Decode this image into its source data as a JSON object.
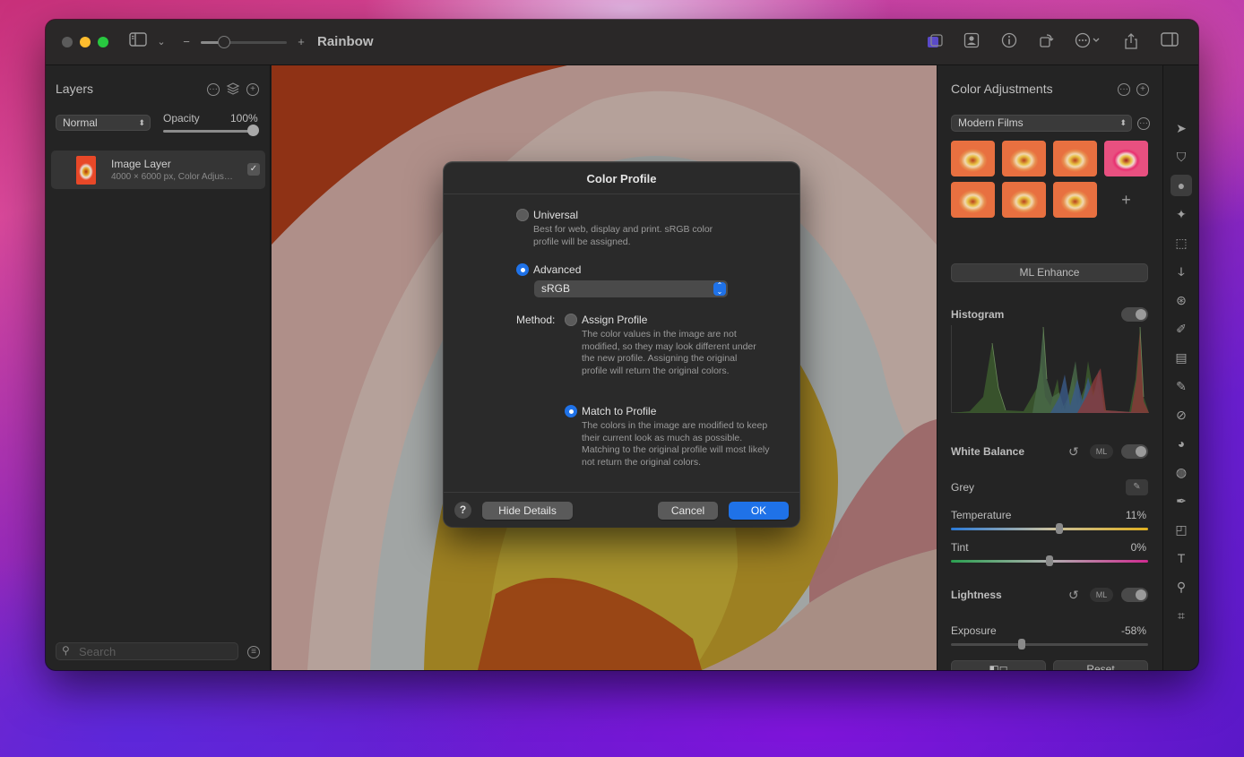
{
  "window": {
    "title": "Rainbow"
  },
  "layers_panel": {
    "title": "Layers",
    "blend_mode": "Normal",
    "opacity_label": "Opacity",
    "opacity_value": "100%",
    "opacity_fraction": 1.0,
    "layers": [
      {
        "name": "Image Layer",
        "meta": "4000 × 6000 px, Color Adjus…",
        "visible": true
      }
    ],
    "search_placeholder": "Search"
  },
  "adjustments_panel": {
    "title": "Color Adjustments",
    "preset_group": "Modern Films",
    "preset_add": "+",
    "ml_enhance": "ML Enhance",
    "histogram": {
      "title": "Histogram"
    },
    "white_balance": {
      "title": "White Balance",
      "ml": "ML",
      "grey_label": "Grey",
      "temperature_label": "Temperature",
      "temperature_value": "11%",
      "temperature_fraction": 0.55,
      "tint_label": "Tint",
      "tint_value": "0%",
      "tint_fraction": 0.5
    },
    "lightness": {
      "title": "Lightness",
      "ml": "ML",
      "exposure_label": "Exposure",
      "exposure_value": "-58%",
      "exposure_fraction": 0.36
    },
    "compare_button": "◧◻",
    "reset_button": "Reset"
  },
  "dialog": {
    "title": "Color Profile",
    "universal": {
      "label": "Universal",
      "description": "Best for web, display and print. sRGB color profile will be assigned.",
      "selected": false
    },
    "advanced": {
      "label": "Advanced",
      "selected": true,
      "profile": "sRGB"
    },
    "method_label": "Method:",
    "assign_profile": {
      "label": "Assign Profile",
      "description": "The color values in the image are not modified, so they may look different under the new profile. Assigning the original profile will return the original colors.",
      "selected": false
    },
    "match_profile": {
      "label": "Match to Profile",
      "description": "The colors in the image are modified to keep their current look as much as possible. Matching to the original profile will most likely not return the original colors.",
      "selected": true
    },
    "help": "?",
    "hide_details": "Hide Details",
    "cancel": "Cancel",
    "ok": "OK"
  },
  "colors": {
    "accent": "#1f72e8",
    "window_bg": "#1f1f1f",
    "panel_bg": "#242424"
  },
  "icons": {
    "toolbar_left": [
      "sidebar-icon",
      "chevron-down-icon",
      "zoom-out-icon",
      "zoom-in-icon"
    ],
    "toolbar_right": [
      "color-profile-icon",
      "person-icon",
      "info-icon",
      "rotate-icon",
      "more-icon",
      "share-icon",
      "sidebar-right-icon"
    ],
    "tools": [
      "arrow-icon",
      "paint-bucket-icon",
      "color-adjust-icon",
      "magic-icon",
      "marquee-icon",
      "lasso-icon",
      "retouch-icon",
      "brush-icon",
      "fill-icon",
      "eraser-icon",
      "bandage-icon",
      "clone-icon",
      "blur-icon",
      "pen-icon",
      "shape-icon",
      "text-icon",
      "zoom-icon",
      "crop-icon",
      "more-icon"
    ]
  }
}
